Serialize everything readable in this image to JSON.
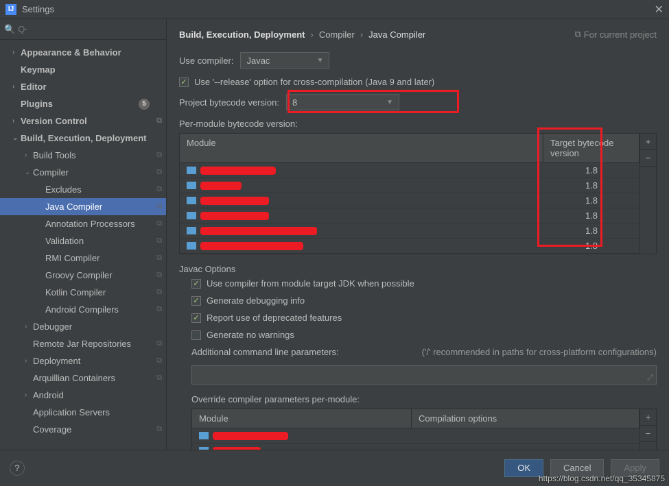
{
  "window": {
    "title": "Settings",
    "icon": "IJ"
  },
  "search": {
    "placeholder": "Q-"
  },
  "sidebar": [
    {
      "label": "Appearance & Behavior",
      "level": 1,
      "arrow": "›",
      "bold": true
    },
    {
      "label": "Keymap",
      "level": 1,
      "bold": true
    },
    {
      "label": "Editor",
      "level": 1,
      "arrow": "›",
      "bold": true
    },
    {
      "label": "Plugins",
      "level": 1,
      "bold": true,
      "badge": "5"
    },
    {
      "label": "Version Control",
      "level": 1,
      "arrow": "›",
      "bold": true,
      "copy": true
    },
    {
      "label": "Build, Execution, Deployment",
      "level": 1,
      "arrow": "⌄",
      "bold": true
    },
    {
      "label": "Build Tools",
      "level": 2,
      "arrow": "›",
      "copy": true
    },
    {
      "label": "Compiler",
      "level": 2,
      "arrow": "⌄",
      "copy": true
    },
    {
      "label": "Excludes",
      "level": 3,
      "copy": true
    },
    {
      "label": "Java Compiler",
      "level": 3,
      "copy": true,
      "selected": true
    },
    {
      "label": "Annotation Processors",
      "level": 3,
      "copy": true
    },
    {
      "label": "Validation",
      "level": 3,
      "copy": true
    },
    {
      "label": "RMI Compiler",
      "level": 3,
      "copy": true
    },
    {
      "label": "Groovy Compiler",
      "level": 3,
      "copy": true
    },
    {
      "label": "Kotlin Compiler",
      "level": 3,
      "copy": true
    },
    {
      "label": "Android Compilers",
      "level": 3,
      "copy": true
    },
    {
      "label": "Debugger",
      "level": 2,
      "arrow": "›"
    },
    {
      "label": "Remote Jar Repositories",
      "level": 2,
      "copy": true
    },
    {
      "label": "Deployment",
      "level": 2,
      "arrow": "›",
      "copy": true
    },
    {
      "label": "Arquillian Containers",
      "level": 2,
      "copy": true
    },
    {
      "label": "Android",
      "level": 2,
      "arrow": "›"
    },
    {
      "label": "Application Servers",
      "level": 2
    },
    {
      "label": "Coverage",
      "level": 2,
      "copy": true
    }
  ],
  "breadcrumb": {
    "parts": [
      "Build, Execution, Deployment",
      "Compiler",
      "Java Compiler"
    ],
    "scope_icon": "⧉",
    "scope_label": "For current project"
  },
  "compiler": {
    "use_compiler_label": "Use compiler:",
    "use_compiler_value": "Javac",
    "release_option": {
      "checked": true,
      "label": "Use '--release' option for cross-compilation (Java 9 and later)"
    },
    "project_bytecode_label": "Project bytecode version:",
    "project_bytecode_value": "8",
    "per_module_label": "Per-module bytecode version:"
  },
  "bytecode_table": {
    "headers": [
      "Module",
      "Target bytecode version"
    ],
    "rows": [
      {
        "redact_w": 110,
        "target": "1.8"
      },
      {
        "redact_w": 60,
        "target": "1.8"
      },
      {
        "redact_w": 100,
        "target": "1.8"
      },
      {
        "redact_w": 100,
        "target": "1.8"
      },
      {
        "redact_w": 170,
        "target": "1.8"
      },
      {
        "redact_w": 150,
        "target": "1.8"
      }
    ]
  },
  "javac": {
    "title": "Javac Options",
    "opts": [
      {
        "checked": true,
        "label": "Use compiler from module target JDK when possible"
      },
      {
        "checked": true,
        "label": "Generate debugging info"
      },
      {
        "checked": true,
        "label": "Report use of deprecated features"
      },
      {
        "checked": false,
        "label": "Generate no warnings"
      }
    ],
    "additional_label": "Additional command line parameters:",
    "additional_hint": "('/' recommended in paths for cross-platform configurations)",
    "override_label": "Override compiler parameters per-module:"
  },
  "override_table": {
    "headers": [
      "Module",
      "Compilation options"
    ],
    "rows": [
      {
        "redact_w": 110
      },
      {
        "redact_w": 70
      },
      {
        "redact_w": 120
      }
    ]
  },
  "footer": {
    "ok": "OK",
    "cancel": "Cancel",
    "apply": "Apply"
  },
  "watermark": "https://blog.csdn.net/qq_35345875"
}
